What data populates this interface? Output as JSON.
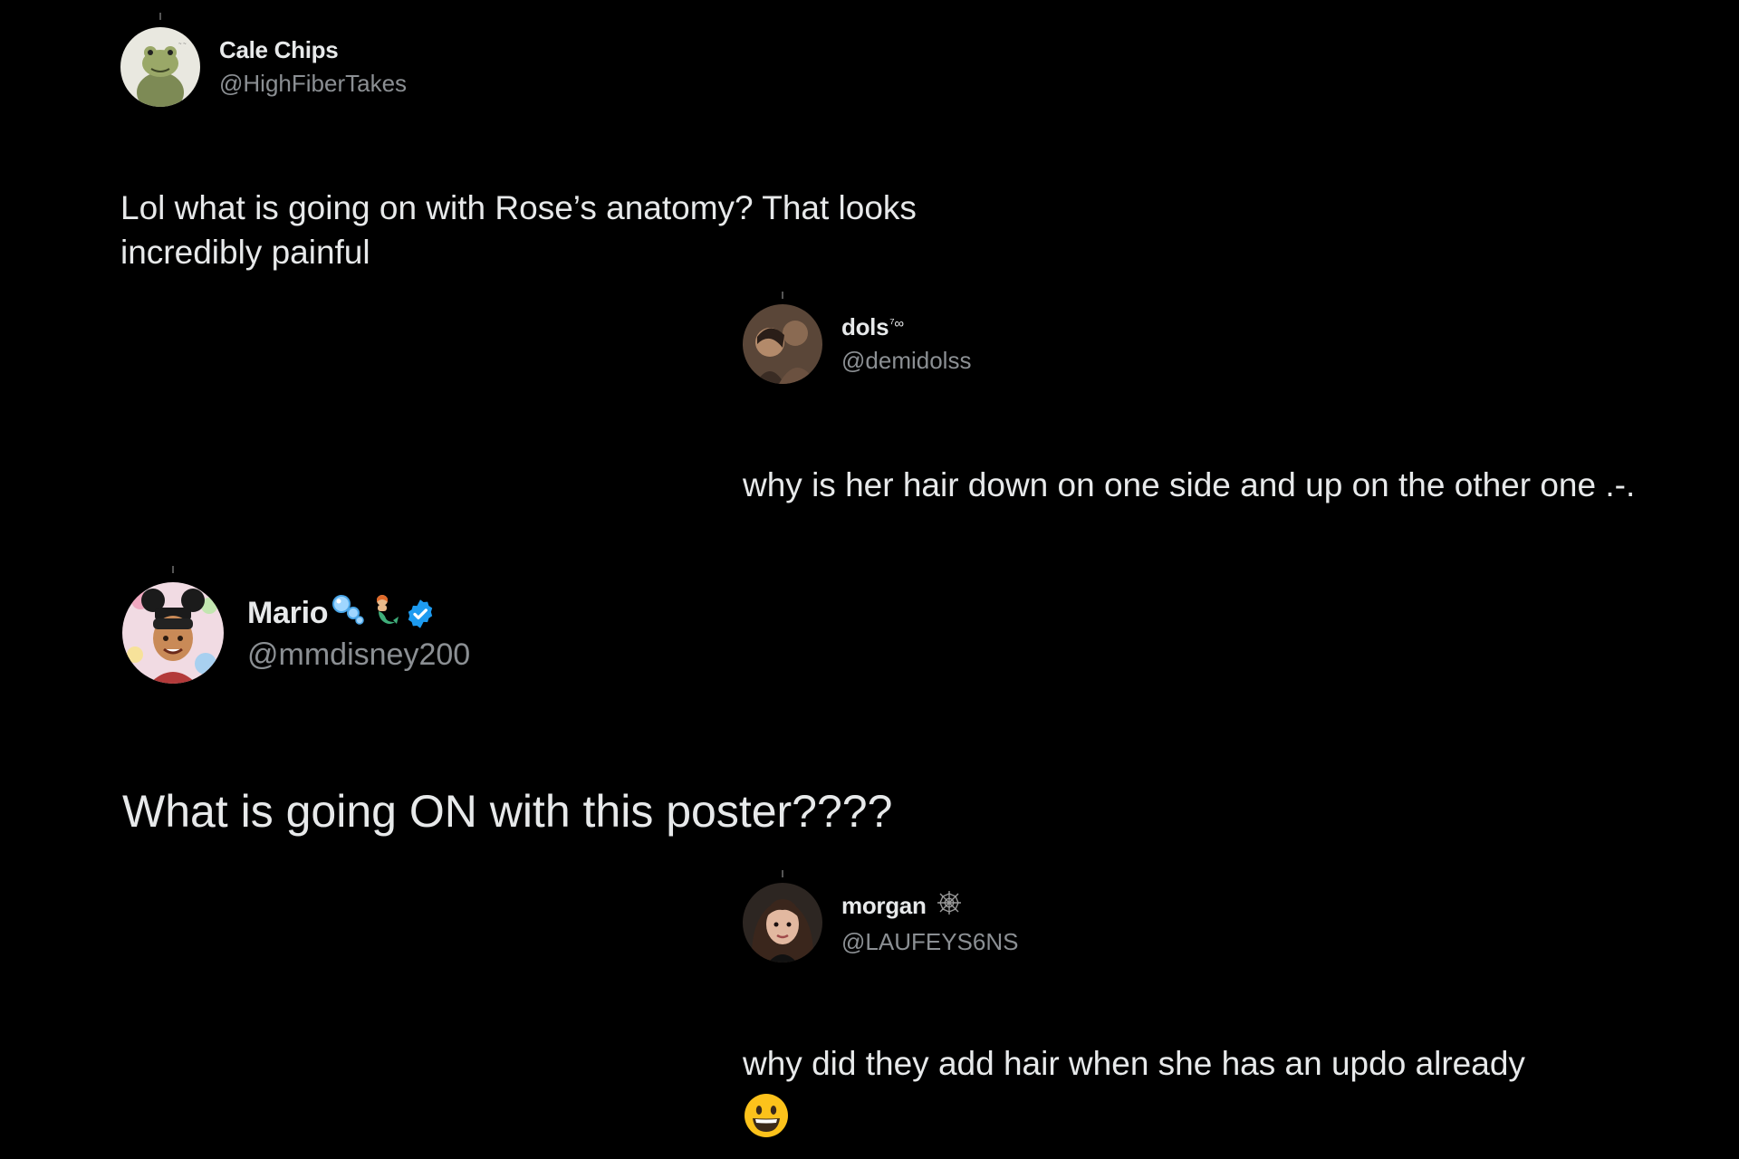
{
  "tweets": [
    {
      "display_name": "Cale Chips",
      "handle": "@HighFiberTakes",
      "avatar": "frog-avatar",
      "text": "Lol what is going on with Rose’s anatomy? That looks incredibly painful"
    },
    {
      "display_name": "dols",
      "name_badge": "⁷∞",
      "handle": "@demidolss",
      "avatar": "photo-avatar",
      "text": "why is her hair down on one side and up on the other one .-."
    },
    {
      "display_name": "Mario",
      "name_emojis": [
        "bubbles-icon",
        "merperson-icon"
      ],
      "verified": true,
      "handle": "@mmdisney200",
      "avatar": "cartoon-mouse-ears-avatar",
      "text": "What is going ON with this poster????"
    },
    {
      "display_name": "morgan",
      "name_emoji": "spider-web-icon",
      "handle": "@LAUFEYS6NS",
      "avatar": "portrait-avatar",
      "text": "why did they add hair when she has an updo already",
      "trailing_emoji": "grinning-face-icon"
    }
  ],
  "colors": {
    "background": "#000000",
    "text": "#e7e9ea",
    "handle": "#8b8f93",
    "verified": "#1d9bf0"
  }
}
